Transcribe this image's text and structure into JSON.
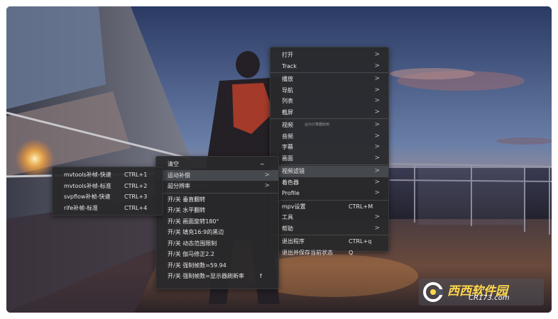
{
  "menu_main": {
    "items": [
      {
        "label": "打开",
        "arrow": ">"
      },
      {
        "label": "Track",
        "arrow": ">"
      },
      {
        "label": "播放",
        "arrow": ">"
      },
      {
        "label": "导航",
        "arrow": ">"
      },
      {
        "label": "列表",
        "arrow": ">"
      },
      {
        "label": "截屏",
        "arrow": ">"
      },
      {
        "label": "视频",
        "arrow": ">",
        "hint": "@为计算器启用"
      },
      {
        "label": "音频",
        "arrow": ">"
      },
      {
        "label": "字幕",
        "arrow": ">"
      },
      {
        "label": "画面",
        "arrow": ">"
      },
      {
        "label": "视频滤镜",
        "arrow": ">"
      },
      {
        "label": "着色器",
        "arrow": ">"
      },
      {
        "label": "Profile",
        "arrow": ">"
      },
      {
        "label": "mpv设置",
        "shortcut": "CTRL+M"
      },
      {
        "label": "工具",
        "arrow": ">"
      },
      {
        "label": "帮助",
        "arrow": ">"
      },
      {
        "label": "退出程序",
        "shortcut": "CTRL+q"
      },
      {
        "label": "退出并保存当前状态",
        "shortcut": "Q"
      }
    ]
  },
  "menu_filter": {
    "items": [
      {
        "label": "清空",
        "shortcut": "~"
      },
      {
        "label": "运动补偿",
        "arrow": ">"
      },
      {
        "label": "超分辨率",
        "arrow": ">"
      },
      {
        "label": "开/关 垂直翻转"
      },
      {
        "label": "开/关 水平翻转"
      },
      {
        "label": "开/关 画面旋转180°"
      },
      {
        "label": "开/关 填充16:9的黑边"
      },
      {
        "label": "开/关 动态范围限制"
      },
      {
        "label": "开/关 伽马修正2.2"
      },
      {
        "label": "开/关 强制帧数=59.94"
      },
      {
        "label": "开/关 强制帧数=显示器刷新率",
        "shortcut": "f"
      }
    ]
  },
  "menu_motion": {
    "items": [
      {
        "label": "mvtools补帧-快速",
        "shortcut": "CTRL+1"
      },
      {
        "label": "mvtools补帧-标准",
        "shortcut": "CTRL+2"
      },
      {
        "label": "svpflow补帧-快速",
        "shortcut": "CTRL+3"
      },
      {
        "label": "rife补帧-标准",
        "shortcut": "CTRL+4"
      }
    ]
  },
  "watermark": {
    "text": "西西软件园",
    "url": "CR173.com"
  },
  "colors": {
    "menu_bg": "#28282a",
    "highlight": "#45484d",
    "text": "#e6e6e6"
  }
}
